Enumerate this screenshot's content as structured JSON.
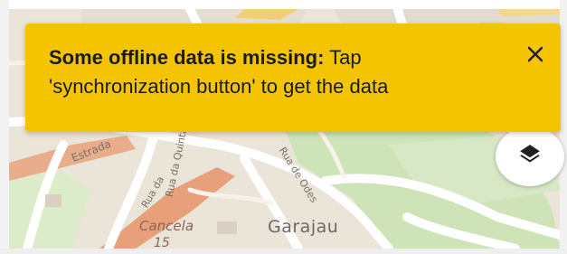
{
  "notification": {
    "title": "Some offline data is missing:",
    "message": " Tap 'synchronization button' to get the data",
    "close_glyph": "✕",
    "background_color": "#f5c400"
  },
  "map": {
    "labels": {
      "garajau": "Garajau",
      "cancela": "Cancela",
      "number": "15",
      "estrada": "Estrada",
      "rua_odes": "Rua de Odes",
      "rua_quinta": "Rua da Quinta",
      "rua_curta": "Rua da"
    },
    "layers_icon": "layers-icon"
  }
}
